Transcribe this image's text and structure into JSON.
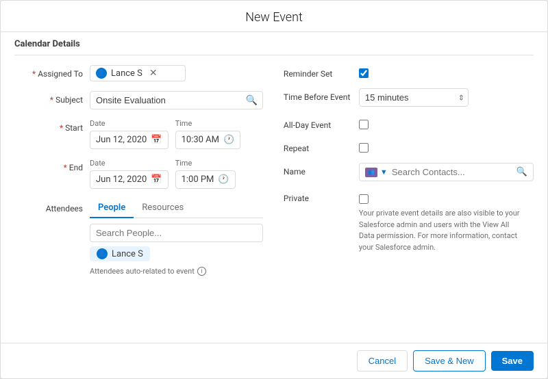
{
  "modal": {
    "title": "New Event"
  },
  "section": {
    "calendar_details": "Calendar Details"
  },
  "form": {
    "assigned_to_label": "Assigned To",
    "assigned_to_value": "Lance S",
    "subject_label": "Subject",
    "subject_value": "Onsite Evaluation",
    "start_label": "Start",
    "end_label": "End",
    "attendees_label": "Attendees",
    "start_date": "Jun 12, 2020",
    "start_time": "10:30 AM",
    "end_date": "Jun 12, 2020",
    "end_time": "1:00 PM",
    "date_sublabel": "Date",
    "time_sublabel": "Time",
    "reminder_set_label": "Reminder Set",
    "time_before_label": "Time Before Event",
    "time_before_value": "15 minutes",
    "all_day_label": "All-Day Event",
    "repeat_label": "Repeat",
    "name_label": "Name",
    "search_contacts_placeholder": "Search Contacts...",
    "private_label": "Private",
    "private_note": "Your private event details are also visible to your Salesforce admin and users with the View All Data permission. For more information, contact your Salesforce admin.",
    "auto_related_note": "Attendees auto-related to event",
    "search_people_placeholder": "Search People...",
    "tab_people": "People",
    "tab_resources": "Resources",
    "attendee_name": "Lance S"
  },
  "footer": {
    "cancel_label": "Cancel",
    "save_new_label": "Save & New",
    "save_label": "Save"
  }
}
